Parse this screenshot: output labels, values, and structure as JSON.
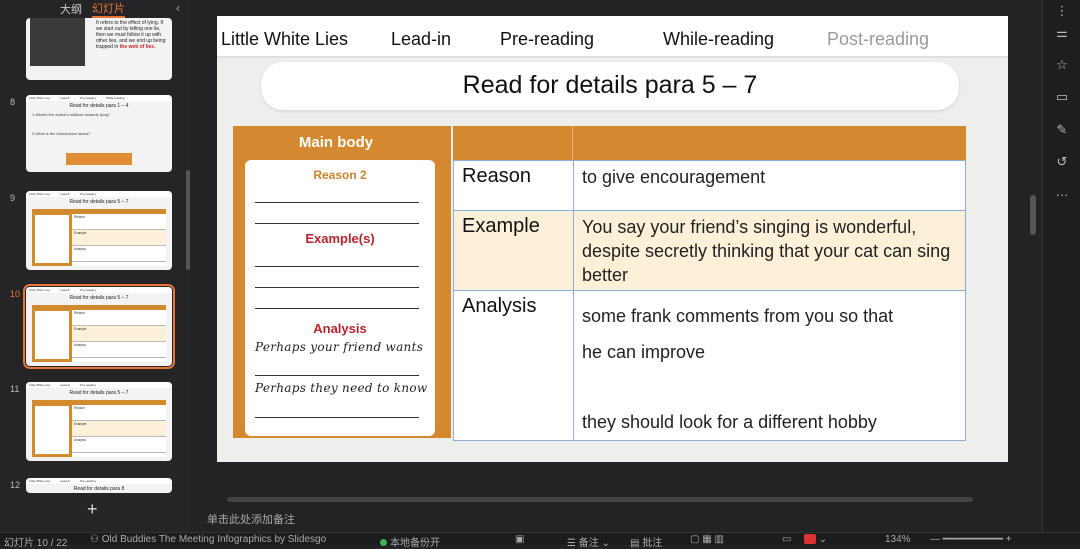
{
  "sidebar": {
    "tab_outline": "大纲",
    "tab_slides": "幻灯片",
    "collapse": "‹",
    "add": "+",
    "thumbs": [
      {
        "num": "8",
        "title": "Read for details para 1 – 4",
        "q1": "1.What's the author's attitude towards lying?",
        "q2": "2.What is the introduction about?"
      },
      {
        "num": "9",
        "title": "Read for details para 5 – 7"
      },
      {
        "num": "10",
        "title": "Read for details para 5 – 7"
      },
      {
        "num": "11",
        "title": "Read for details para 5 – 7"
      },
      {
        "num": "12",
        "title": "Read for details para 8"
      }
    ],
    "top_thumb_text_a": "It refers to the effect of lying. If we start out by telling one lie, then we must follow it up with other lies, and we end up being trapped in",
    "top_thumb_text_b": "the web of lies."
  },
  "nav": {
    "items": [
      "Little White Lies",
      "Lead-in",
      "Pre-reading",
      "While-reading",
      "Post-reading"
    ]
  },
  "slide": {
    "title": "Read for details para 5 – 7",
    "main_body": "Main body",
    "reason_label": "Reason 2",
    "example_label": "Example(s)",
    "analysis_label": "Analysis",
    "hand1": "Perhaps your friend wants",
    "hand2": "Perhaps they need to know",
    "rows": [
      {
        "label": "Reason",
        "text": "to give encouragement"
      },
      {
        "label": "Example",
        "text": "You say your friend’s singing is wonderful, despite secretly thinking that your cat can sing better"
      },
      {
        "label": "Analysis",
        "text1": "some frank comments from you so that",
        "text2": "he can improve",
        "text3": "they should look for a different hobby"
      }
    ]
  },
  "notes_placeholder": "单击此处添加备注",
  "status": {
    "slide_count": "幻灯片 10 / 22",
    "theme": "Old Buddies The Meeting Infographics by Slidesgo",
    "backup": "本地备份开",
    "notes": "备注",
    "comments": "批注",
    "zoom": "134%"
  },
  "colors": {
    "accent": "#e8743a",
    "orange": "#d48930",
    "table_border": "#8eb0d8",
    "row_alt": "#fdf0d8"
  }
}
